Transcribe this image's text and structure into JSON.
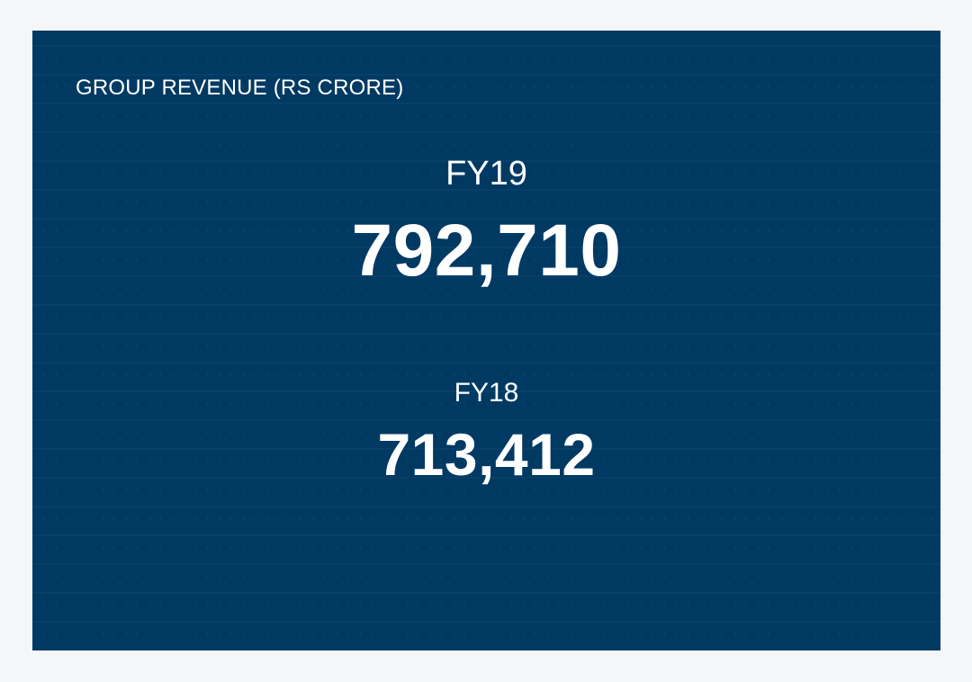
{
  "card": {
    "title": "GROUP REVENUE (RS CRORE)",
    "background_color": "#003a63",
    "text_color": "#ffffff"
  },
  "metrics": [
    {
      "period": "FY19",
      "value": "792,710"
    },
    {
      "period": "FY18",
      "value": "713,412"
    }
  ]
}
